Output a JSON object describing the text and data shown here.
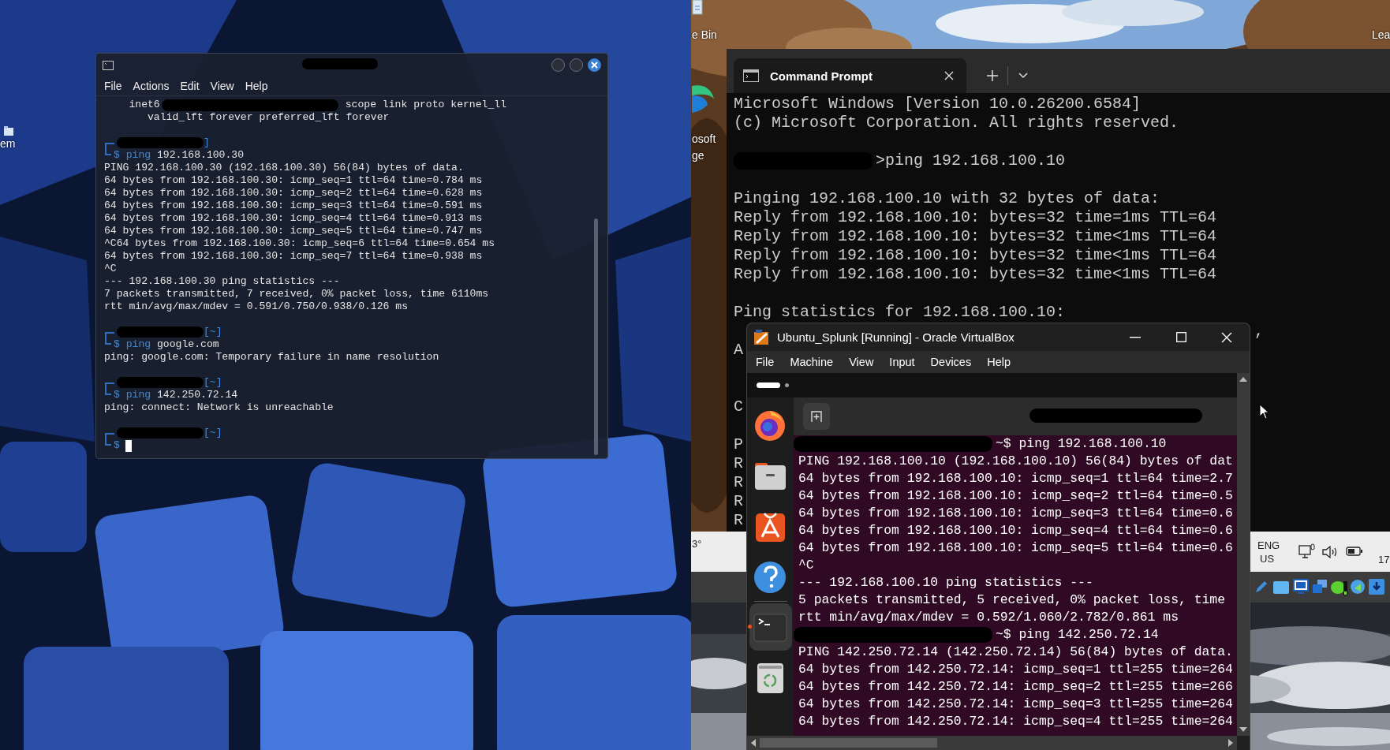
{
  "left_desktop": {
    "icon_label": "em"
  },
  "kali_terminal": {
    "menu": [
      "File",
      "Actions",
      "Edit",
      "View",
      "Help"
    ],
    "lines": [
      {
        "kind": "out_redacted",
        "before": "    inet6",
        "after": "scope link proto kernel_ll"
      },
      {
        "kind": "out",
        "text": "       valid_lft forever preferred_lft forever"
      },
      {
        "kind": "blank"
      },
      {
        "kind": "top",
        "suffix": "]"
      },
      {
        "kind": "cmd",
        "symbol": "$",
        "command": "ping",
        "args": "192.168.100.30"
      },
      {
        "kind": "out",
        "text": "PING 192.168.100.30 (192.168.100.30) 56(84) bytes of data."
      },
      {
        "kind": "out",
        "text": "64 bytes from 192.168.100.30: icmp_seq=1 ttl=64 time=0.784 ms"
      },
      {
        "kind": "out",
        "text": "64 bytes from 192.168.100.30: icmp_seq=2 ttl=64 time=0.628 ms"
      },
      {
        "kind": "out",
        "text": "64 bytes from 192.168.100.30: icmp_seq=3 ttl=64 time=0.591 ms"
      },
      {
        "kind": "out",
        "text": "64 bytes from 192.168.100.30: icmp_seq=4 ttl=64 time=0.913 ms"
      },
      {
        "kind": "out",
        "text": "64 bytes from 192.168.100.30: icmp_seq=5 ttl=64 time=0.747 ms"
      },
      {
        "kind": "out",
        "text": "^C64 bytes from 192.168.100.30: icmp_seq=6 ttl=64 time=0.654 ms"
      },
      {
        "kind": "out",
        "text": "64 bytes from 192.168.100.30: icmp_seq=7 ttl=64 time=0.938 ms"
      },
      {
        "kind": "out",
        "text": "^C"
      },
      {
        "kind": "out",
        "text": "--- 192.168.100.30 ping statistics ---"
      },
      {
        "kind": "out",
        "text": "7 packets transmitted, 7 received, 0% packet loss, time 6110ms"
      },
      {
        "kind": "out",
        "text": "rtt min/avg/max/mdev = 0.591/0.750/0.938/0.126 ms"
      },
      {
        "kind": "blank"
      },
      {
        "kind": "top",
        "suffix": "[~]"
      },
      {
        "kind": "cmd",
        "symbol": "$",
        "command": "ping",
        "args": "google.com"
      },
      {
        "kind": "out",
        "text": "ping: google.com: Temporary failure in name resolution"
      },
      {
        "kind": "blank"
      },
      {
        "kind": "top",
        "suffix": "[~]"
      },
      {
        "kind": "cmd",
        "symbol": "$",
        "command": "ping",
        "args": "142.250.72.14"
      },
      {
        "kind": "out",
        "text": "ping: connect: Network is unreachable"
      },
      {
        "kind": "blank"
      },
      {
        "kind": "top",
        "suffix": "[~]"
      },
      {
        "kind": "input",
        "symbol": "$"
      }
    ]
  },
  "right_desktop": {
    "recycle_label": "e Bin",
    "corner_label": "Lea",
    "edge_label": [
      "osoft",
      "ge"
    ]
  },
  "command_prompt": {
    "tab": "Command Prompt",
    "lines": [
      {
        "kind": "text",
        "text": "Microsoft Windows [Version 10.0.26200.6584]"
      },
      {
        "kind": "text",
        "text": "(c) Microsoft Corporation. All rights reserved."
      },
      {
        "kind": "blank"
      },
      {
        "kind": "prompt",
        "text": ">ping 192.168.100.10"
      },
      {
        "kind": "blank"
      },
      {
        "kind": "text",
        "text": "Pinging 192.168.100.10 with 32 bytes of data:"
      },
      {
        "kind": "text",
        "text": "Reply from 192.168.100.10: bytes=32 time=1ms TTL=64"
      },
      {
        "kind": "text",
        "text": "Reply from 192.168.100.10: bytes=32 time<1ms TTL=64"
      },
      {
        "kind": "text",
        "text": "Reply from 192.168.100.10: bytes=32 time<1ms TTL=64"
      },
      {
        "kind": "text",
        "text": "Reply from 192.168.100.10: bytes=32 time<1ms TTL=64"
      },
      {
        "kind": "blank"
      },
      {
        "kind": "text",
        "text": "Ping statistics for 192.168.100.10:"
      },
      {
        "kind": "tail",
        "text": ","
      },
      {
        "kind": "text",
        "text": "A"
      },
      {
        "kind": "blank"
      },
      {
        "kind": "blank"
      },
      {
        "kind": "text",
        "text": "C"
      },
      {
        "kind": "blank"
      },
      {
        "kind": "text",
        "text": "P"
      },
      {
        "kind": "text",
        "text": "R"
      },
      {
        "kind": "text",
        "text": "R"
      },
      {
        "kind": "text",
        "text": "R"
      },
      {
        "kind": "text",
        "text": "R"
      }
    ]
  },
  "taskbar": {
    "weather": "3°",
    "language": [
      "ENG",
      "US"
    ],
    "clock": "17"
  },
  "virtualbox": {
    "title": "Ubuntu_Splunk [Running] - Oracle VirtualBox",
    "menu": [
      "File",
      "Machine",
      "View",
      "Input",
      "Devices",
      "Help"
    ],
    "dock": [
      {
        "kind": "browser",
        "selected": false,
        "running": false
      },
      {
        "kind": "files",
        "selected": false,
        "running": false
      },
      {
        "kind": "store",
        "selected": false,
        "running": false
      },
      {
        "kind": "help",
        "selected": false,
        "running": false
      },
      {
        "kind": "terminal",
        "selected": true,
        "running": true
      },
      {
        "kind": "trash",
        "selected": false,
        "running": false
      }
    ],
    "lines": [
      {
        "kind": "prompt",
        "text": "~$ ping 192.168.100.10"
      },
      {
        "kind": "text",
        "text": "PING 192.168.100.10 (192.168.100.10) 56(84) bytes of dat"
      },
      {
        "kind": "text",
        "text": "64 bytes from 192.168.100.10: icmp_seq=1 ttl=64 time=2.7"
      },
      {
        "kind": "text",
        "text": "64 bytes from 192.168.100.10: icmp_seq=2 ttl=64 time=0.5"
      },
      {
        "kind": "text",
        "text": "64 bytes from 192.168.100.10: icmp_seq=3 ttl=64 time=0.6"
      },
      {
        "kind": "text",
        "text": "64 bytes from 192.168.100.10: icmp_seq=4 ttl=64 time=0.6"
      },
      {
        "kind": "text",
        "text": "64 bytes from 192.168.100.10: icmp_seq=5 ttl=64 time=0.6"
      },
      {
        "kind": "text",
        "text": "^C"
      },
      {
        "kind": "text",
        "text": "--- 192.168.100.10 ping statistics ---"
      },
      {
        "kind": "text",
        "text": "5 packets transmitted, 5 received, 0% packet loss, time"
      },
      {
        "kind": "text",
        "text": "rtt min/avg/max/mdev = 0.592/1.060/2.782/0.861 ms"
      },
      {
        "kind": "prompt",
        "text": "~$ ping 142.250.72.14"
      },
      {
        "kind": "text",
        "text": "PING 142.250.72.14 (142.250.72.14) 56(84) bytes of data."
      },
      {
        "kind": "text",
        "text": "64 bytes from 142.250.72.14: icmp_seq=1 ttl=255 time=264"
      },
      {
        "kind": "text",
        "text": "64 bytes from 142.250.72.14: icmp_seq=2 ttl=255 time=266"
      },
      {
        "kind": "text",
        "text": "64 bytes from 142.250.72.14: icmp_seq=3 ttl=255 time=264"
      },
      {
        "kind": "text",
        "text": "64 bytes from 142.250.72.14: icmp_seq=4 ttl=255 time=264"
      }
    ]
  }
}
